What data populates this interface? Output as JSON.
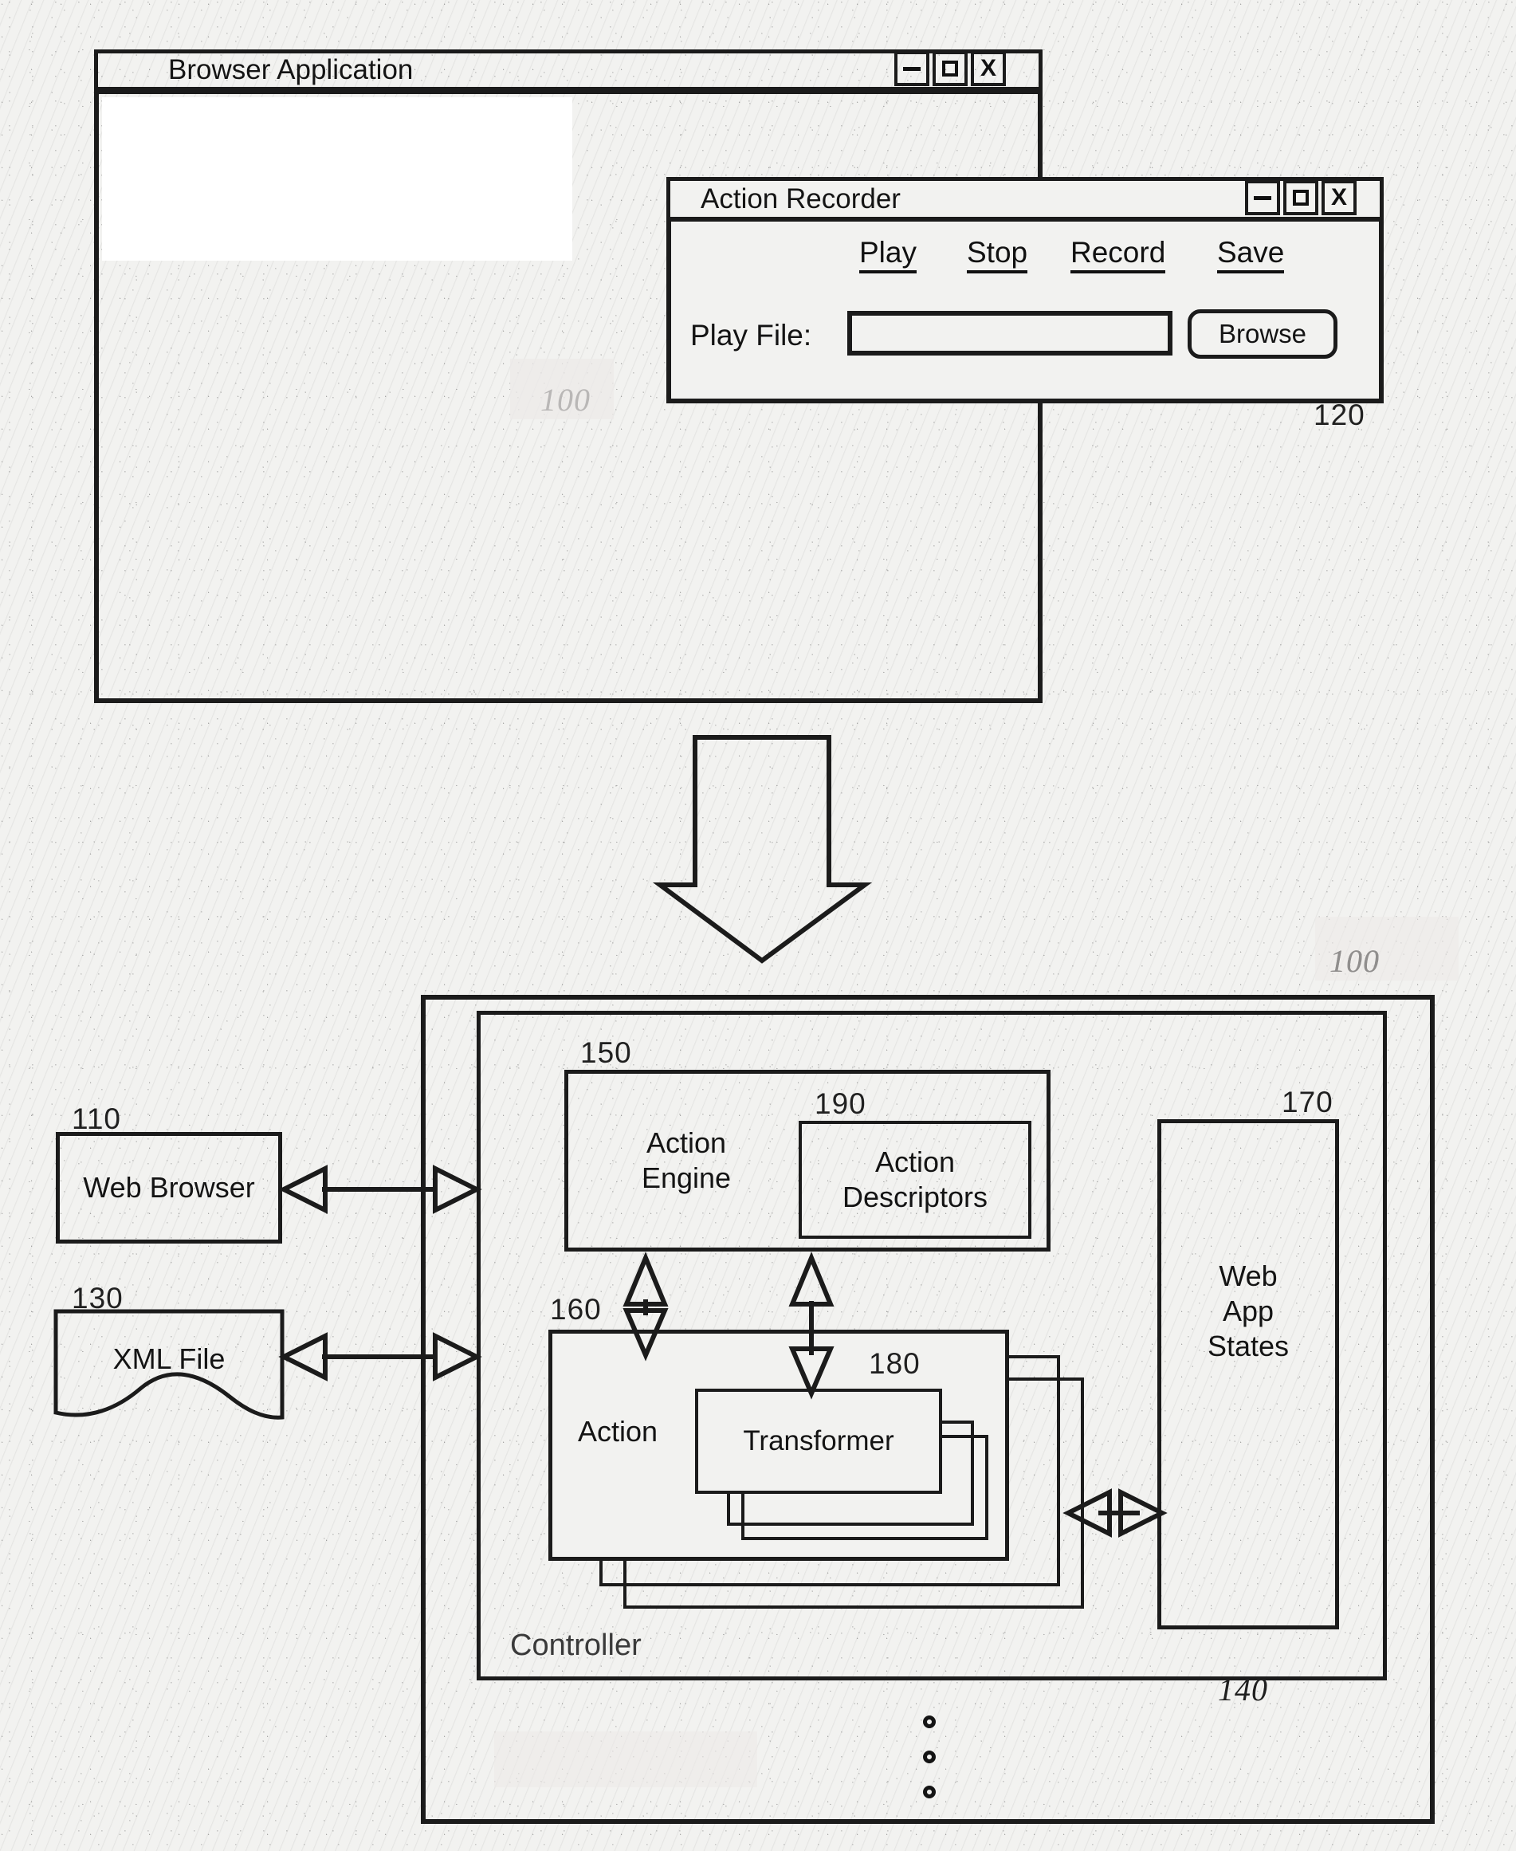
{
  "figure": {
    "style": "patent-line-drawing",
    "ink_color": "#141414",
    "paper_color": "#f2f2f0"
  },
  "browser_window": {
    "title": "Browser Application",
    "ref": "100",
    "controls": [
      {
        "name": "minimize",
        "glyph": "–"
      },
      {
        "name": "maximize",
        "glyph": "□"
      },
      {
        "name": "close",
        "glyph": "X"
      }
    ]
  },
  "action_recorder": {
    "title": "Action Recorder",
    "ref": "120",
    "menu": [
      {
        "label": "Play"
      },
      {
        "label": "Stop"
      },
      {
        "label": "Record"
      },
      {
        "label": "Save"
      }
    ],
    "play_file": {
      "label": "Play File:",
      "value": "",
      "placeholder": ""
    },
    "browse_button": "Browse",
    "controls": [
      {
        "name": "minimize",
        "glyph": "–"
      },
      {
        "name": "maximize",
        "glyph": "□"
      },
      {
        "name": "close",
        "glyph": "X"
      }
    ]
  },
  "system_diagram": {
    "ref_outer": "100",
    "ref_controller": "140",
    "controller_label": "Controller",
    "web_browser": {
      "label": "Web Browser",
      "ref": "110"
    },
    "xml_file": {
      "label": "XML File",
      "ref": "130"
    },
    "action_engine": {
      "label": "Action\nEngine",
      "ref": "150"
    },
    "action_descriptors": {
      "label": "Action\nDescriptors",
      "ref": "190"
    },
    "action": {
      "label": "Action",
      "ref": "160"
    },
    "transformer": {
      "label": "Transformer",
      "ref": "180"
    },
    "web_app_states": {
      "label": "Web\nApp\nStates",
      "ref": "170"
    },
    "continuation_dots": "⋮"
  }
}
